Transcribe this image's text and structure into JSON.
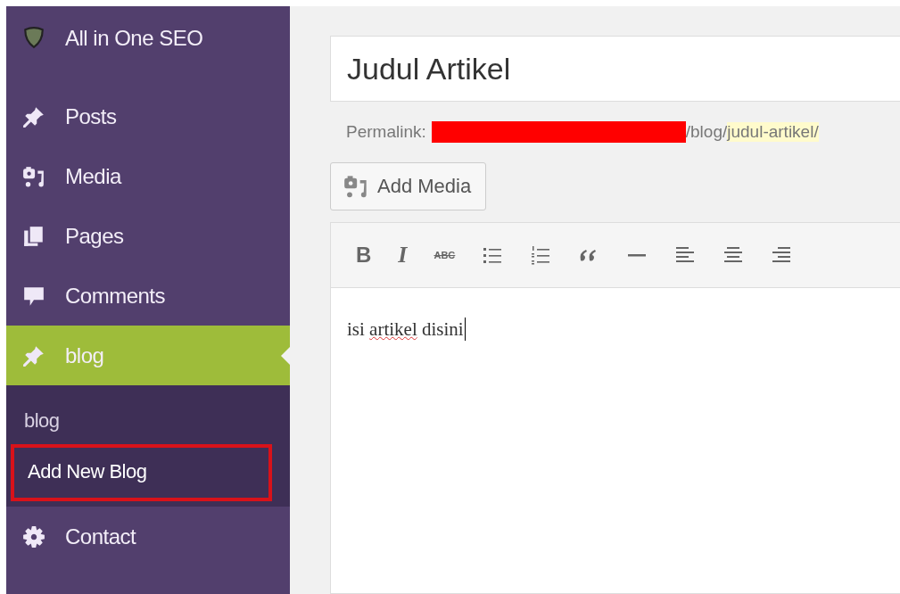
{
  "sidebar": {
    "items": [
      {
        "label": "All in One SEO",
        "kind": "shield",
        "selected": false
      },
      {
        "label": "Posts",
        "kind": "pin",
        "selected": false
      },
      {
        "label": "Media",
        "kind": "media",
        "selected": false
      },
      {
        "label": "Pages",
        "kind": "pages",
        "selected": false
      },
      {
        "label": "Comments",
        "kind": "comment",
        "selected": false
      },
      {
        "label": "blog",
        "kind": "pin",
        "selected": true,
        "submenu": [
          {
            "label": "blog",
            "selected": false,
            "highlighted": false
          },
          {
            "label": "Add New Blog",
            "selected": false,
            "highlighted": true
          }
        ]
      },
      {
        "label": "Contact",
        "kind": "gear",
        "selected": false
      }
    ]
  },
  "editor": {
    "title": "Judul Artikel",
    "permalink": {
      "label": "Permalink:",
      "prefix": "/blog/",
      "slug": "judul-artikel/"
    },
    "add_media": "Add Media",
    "toolbar": [
      {
        "kind": "bold",
        "label": "B"
      },
      {
        "kind": "italic",
        "label": "I"
      },
      {
        "kind": "strike",
        "label": "ABC"
      },
      {
        "kind": "bullets"
      },
      {
        "kind": "numbers"
      },
      {
        "kind": "quote"
      },
      {
        "kind": "rule"
      },
      {
        "kind": "align-left"
      },
      {
        "kind": "align-center"
      },
      {
        "kind": "align-right"
      }
    ],
    "content": [
      {
        "text": "isi ",
        "misspelled": false
      },
      {
        "text": "artikel",
        "misspelled": true
      },
      {
        "text": " disini",
        "misspelled": false
      }
    ]
  }
}
